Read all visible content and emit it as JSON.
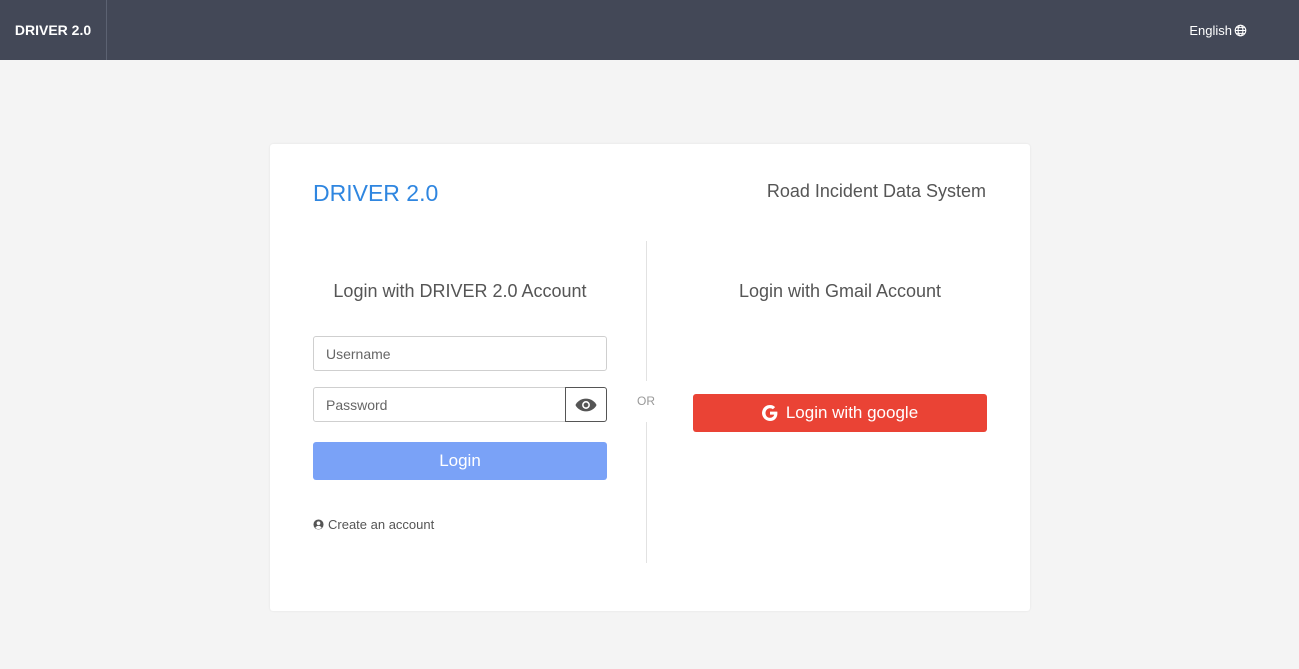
{
  "header": {
    "brand": "DRIVER 2.0",
    "language": "English",
    "language_icon": "globe-icon"
  },
  "card": {
    "title": "DRIVER 2.0",
    "subtitle": "Road Incident Data System",
    "separator": "OR"
  },
  "local_login": {
    "heading": "Login with DRIVER 2.0 Account",
    "username_placeholder": "Username",
    "username_value": "",
    "password_placeholder": "Password",
    "password_value": "",
    "toggle_icon": "eye-icon",
    "login_label": "Login",
    "create_account_label": "Create an account",
    "create_account_icon": "user-circle-icon"
  },
  "gmail_login": {
    "heading": "Login with Gmail Account",
    "button_label": "Login with google",
    "button_icon": "google-icon"
  },
  "colors": {
    "topbar": "#434857",
    "title_blue": "#2f86e0",
    "login_button": "#7aa2f7",
    "google_button": "#ea4335"
  }
}
